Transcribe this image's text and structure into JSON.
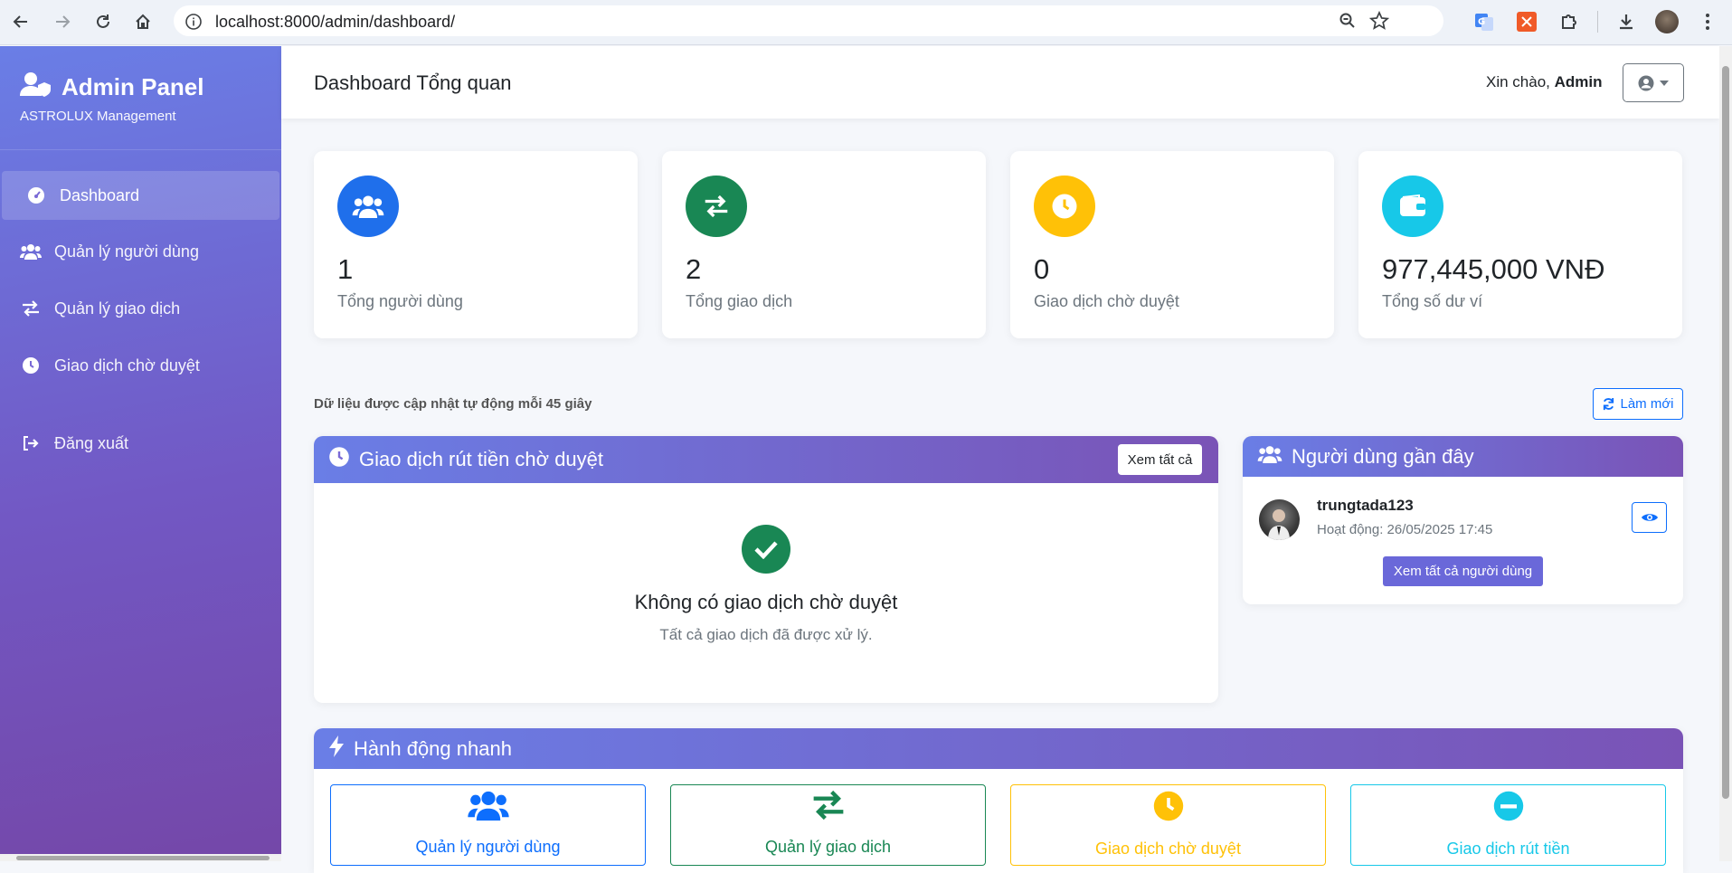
{
  "browser": {
    "url": "localhost:8000/admin/dashboard/"
  },
  "sidebar": {
    "brand_title": "Admin Panel",
    "brand_subtitle": "ASTROLUX Management",
    "items": [
      {
        "label": "Dashboard",
        "icon": "tachometer-icon"
      },
      {
        "label": "Quản lý người dùng",
        "icon": "users-icon"
      },
      {
        "label": "Quản lý giao dịch",
        "icon": "exchange-icon"
      },
      {
        "label": "Giao dịch chờ duyệt",
        "icon": "clock-icon"
      },
      {
        "label": "Đăng xuất",
        "icon": "sign-out-icon"
      }
    ]
  },
  "header": {
    "title": "Dashboard Tổng quan",
    "greeting_prefix": "Xin chào,",
    "greeting_name": "Admin"
  },
  "stats": [
    {
      "value": "1",
      "label": "Tổng người dùng",
      "color": "#1f6feb",
      "icon": "users-icon"
    },
    {
      "value": "2",
      "label": "Tổng giao dịch",
      "color": "#198754",
      "icon": "exchange-icon"
    },
    {
      "value": "0",
      "label": "Giao dịch chờ duyệt",
      "color": "#ffc107",
      "icon": "clock-icon"
    },
    {
      "value": "977,445,000 VNĐ",
      "label": "Tổng số dư ví",
      "color": "#17c8e8",
      "icon": "wallet-icon"
    }
  ],
  "update_note": "Dữ liệu được cập nhật tự động mỗi 45 giây",
  "refresh_label": "Làm mới",
  "pending_panel": {
    "title": "Giao dịch rút tiền chờ duyệt",
    "view_all": "Xem tất cả",
    "empty_title": "Không có giao dịch chờ duyệt",
    "empty_sub": "Tất cả giao dịch đã được xử lý."
  },
  "recent_users": {
    "title": "Người dùng gần đây",
    "users": [
      {
        "username": "trungtada123",
        "activity": "Hoạt động: 26/05/2025 17:45"
      }
    ],
    "view_all": "Xem tất cả người dùng"
  },
  "quick_actions": {
    "title": "Hành động nhanh",
    "items": [
      {
        "label": "Quản lý người dùng",
        "color": "#0d6efd",
        "icon": "users-icon"
      },
      {
        "label": "Quản lý giao dịch",
        "color": "#198754",
        "icon": "exchange-icon"
      },
      {
        "label": "Giao dịch chờ duyệt",
        "color": "#ffc107",
        "icon": "clock-icon"
      },
      {
        "label": "Giao dịch rút tiền",
        "color": "#17c8e8",
        "icon": "minus-circle-icon"
      }
    ]
  }
}
